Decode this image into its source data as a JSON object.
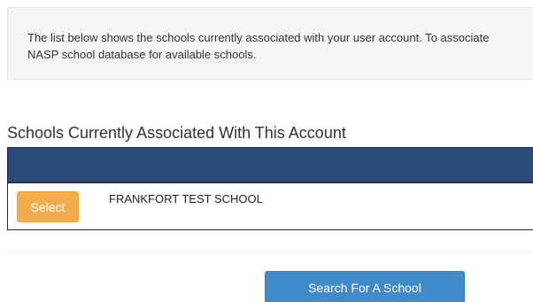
{
  "info": {
    "line1": "The list below shows the schools currently associated with your user account. To associate",
    "line2": "NASP school database for available schools."
  },
  "section": {
    "title": "Schools Currently Associated With This Account"
  },
  "table": {
    "rows": [
      {
        "button_label": "Select",
        "school_name": "FRANKFORT TEST SCHOOL"
      }
    ]
  },
  "actions": {
    "search_label": "Search For A School"
  },
  "colors": {
    "header_bg": "#2a4a7a",
    "select_button": "#f0ad4e",
    "search_button": "#428bca"
  }
}
